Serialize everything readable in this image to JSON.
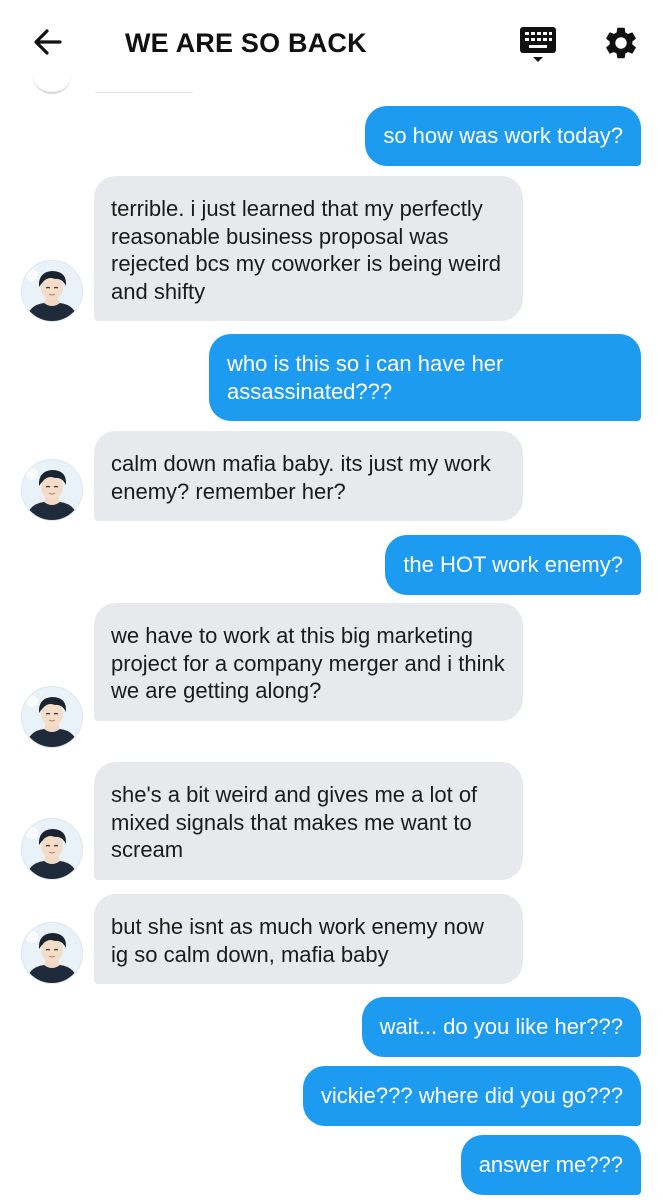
{
  "header": {
    "title": "WE ARE SO BACK",
    "back_icon": "arrow-left-icon",
    "keyboard_icon": "keyboard-icon",
    "settings_icon": "gear-icon"
  },
  "colors": {
    "outgoing_bubble": "#1d9bf0",
    "incoming_bubble": "#e7e9ec",
    "text_dark": "#1b1b1b"
  },
  "messages": [
    {
      "direction": "out",
      "text": "so how was work today?"
    },
    {
      "direction": "in",
      "text": "terrible. i just learned that my perfectly reasonable business proposal was rejected bcs my coworker is being weird and shifty"
    },
    {
      "direction": "out",
      "text": "who is this so i can have her assassinated???"
    },
    {
      "direction": "in",
      "text": "calm down mafia baby. its just my work enemy? remember her?"
    },
    {
      "direction": "out",
      "text": "the HOT work enemy?"
    },
    {
      "direction": "in",
      "text": "we have to work at this big marketing project for a company merger and i think we are getting along?"
    },
    {
      "direction": "in",
      "text": "she's a bit weird and gives me a lot of mixed signals that makes me want to scream"
    },
    {
      "direction": "in",
      "text": "but she isnt as much work enemy now ig so calm down, mafia baby"
    },
    {
      "direction": "out",
      "text": "wait... do you like her???"
    },
    {
      "direction": "out",
      "text": "vickie??? where did you go???"
    },
    {
      "direction": "out",
      "text": "answer me???"
    }
  ]
}
